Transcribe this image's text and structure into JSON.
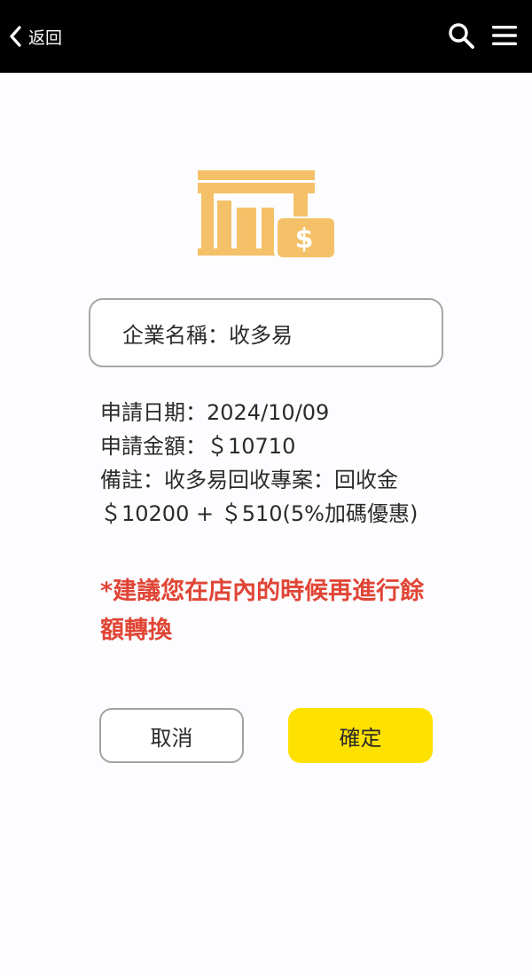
{
  "header": {
    "back_label": "返回",
    "icons": [
      "chevron-left-icon",
      "search-icon",
      "menu-icon"
    ]
  },
  "store_icon": {
    "symbol": "$",
    "color": "#f5c168"
  },
  "company": {
    "text": "企業名稱：收多易"
  },
  "details": {
    "date": "申請日期：2024/10/09",
    "amount": "申請金額：＄10710",
    "note_line1": "備註：收多易回收專案：回收金",
    "note_line2": "＄10200 + ＄510(5%加碼優惠)"
  },
  "notice": {
    "text": "*建議您在店內的時候再進行餘額轉換",
    "color": "#e04535"
  },
  "buttons": {
    "cancel": "取消",
    "confirm": "確定",
    "confirm_color": "#ffe100"
  }
}
